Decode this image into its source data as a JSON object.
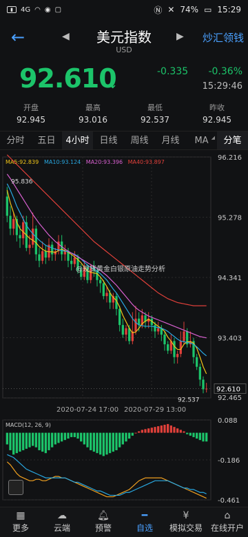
{
  "status_bar": {
    "carrier_left": "4G",
    "battery": "74%",
    "time": "15:29"
  },
  "header": {
    "title": "美元指数",
    "subtitle": "USD",
    "right_link": "炒汇领钱"
  },
  "quote": {
    "price": "92.610",
    "change": "-0.335",
    "change_pct": "-0.36%",
    "time": "15:29:46"
  },
  "stats": [
    {
      "label": "开盘",
      "value": "92.945"
    },
    {
      "label": "最高",
      "value": "93.016"
    },
    {
      "label": "最低",
      "value": "92.537"
    },
    {
      "label": "昨收",
      "value": "92.945"
    }
  ],
  "tabs": [
    "分时",
    "五日",
    "4小时",
    "日线",
    "周线",
    "月线",
    "MA",
    "分笔"
  ],
  "chart_data": {
    "type": "candlestick",
    "ma_legend": [
      {
        "label": "MA5:92.839",
        "color": "#f0c419"
      },
      {
        "label": "MA10:93.124",
        "color": "#29a7e0"
      },
      {
        "label": "MA20:93.396",
        "color": "#d860d0"
      },
      {
        "label": "MA40:93.897",
        "color": "#e0403a"
      }
    ],
    "y_ticks": [
      "96.216",
      "95.278",
      "94.341",
      "93.403",
      "92.465"
    ],
    "current_price_label": "92.610",
    "annotations": [
      {
        "label": "95.836"
      },
      {
        "label": "92.537"
      }
    ],
    "x_ticks": [
      "2020-07-24 17:00",
      "2020-07-29 13:00"
    ],
    "ylim": [
      92.465,
      96.216
    ],
    "candles": [
      [
        95.6,
        95.3,
        95.75,
        95.2
      ],
      [
        95.3,
        95.1,
        95.45,
        95.0
      ],
      [
        95.1,
        95.25,
        95.35,
        95.0
      ],
      [
        95.25,
        95.0,
        95.3,
        94.9
      ],
      [
        95.0,
        94.95,
        95.15,
        94.8
      ],
      [
        94.95,
        95.2,
        95.3,
        94.85
      ],
      [
        95.2,
        94.8,
        95.3,
        94.75
      ],
      [
        94.8,
        94.85,
        95.0,
        94.7
      ],
      [
        94.85,
        95.1,
        95.35,
        94.8
      ],
      [
        95.1,
        94.7,
        95.15,
        94.6
      ],
      [
        94.7,
        94.6,
        94.8,
        94.5
      ],
      [
        94.6,
        94.75,
        94.9,
        94.55
      ],
      [
        94.75,
        94.65,
        94.85,
        94.55
      ],
      [
        94.65,
        94.85,
        94.95,
        94.6
      ],
      [
        94.85,
        94.7,
        94.9,
        94.6
      ],
      [
        94.7,
        94.75,
        94.8,
        94.6
      ],
      [
        94.75,
        94.9,
        95.0,
        94.7
      ],
      [
        94.9,
        94.7,
        95.0,
        94.6
      ],
      [
        94.7,
        94.75,
        94.85,
        94.6
      ],
      [
        94.75,
        94.6,
        94.8,
        94.5
      ],
      [
        94.6,
        94.55,
        94.7,
        94.45
      ],
      [
        94.55,
        94.65,
        94.75,
        94.5
      ],
      [
        94.65,
        94.45,
        94.7,
        94.4
      ],
      [
        94.45,
        94.35,
        94.55,
        94.3
      ],
      [
        94.35,
        94.5,
        94.6,
        94.3
      ],
      [
        94.5,
        94.3,
        94.55,
        94.25
      ],
      [
        94.3,
        94.5,
        94.55,
        94.25
      ],
      [
        94.5,
        94.45,
        94.6,
        94.35
      ],
      [
        94.45,
        94.3,
        94.5,
        94.2
      ],
      [
        94.3,
        94.25,
        94.35,
        94.1
      ],
      [
        94.25,
        94.05,
        94.3,
        94.0
      ],
      [
        94.05,
        94.1,
        94.2,
        93.95
      ],
      [
        94.1,
        93.95,
        94.15,
        93.85
      ],
      [
        93.95,
        94.05,
        94.1,
        93.85
      ],
      [
        94.05,
        93.85,
        94.1,
        93.75
      ],
      [
        93.85,
        93.6,
        93.9,
        93.5
      ],
      [
        93.6,
        93.45,
        93.7,
        93.4
      ],
      [
        93.45,
        93.55,
        93.6,
        93.35
      ],
      [
        93.55,
        93.35,
        93.6,
        93.3
      ],
      [
        93.35,
        93.5,
        93.8,
        93.3
      ],
      [
        93.5,
        93.7,
        93.9,
        93.45
      ],
      [
        93.7,
        93.6,
        93.8,
        93.5
      ],
      [
        93.6,
        93.75,
        93.85,
        93.55
      ],
      [
        93.75,
        93.65,
        93.8,
        93.55
      ],
      [
        93.65,
        93.7,
        93.8,
        93.55
      ],
      [
        93.7,
        93.6,
        93.75,
        93.5
      ],
      [
        93.6,
        93.5,
        93.65,
        93.4
      ],
      [
        93.5,
        93.55,
        93.65,
        93.45
      ],
      [
        93.55,
        93.45,
        93.6,
        93.35
      ],
      [
        93.45,
        93.3,
        93.5,
        93.2
      ],
      [
        93.3,
        93.2,
        93.35,
        93.15
      ],
      [
        93.2,
        93.35,
        93.45,
        93.15
      ],
      [
        93.35,
        93.1,
        93.4,
        93.0
      ],
      [
        93.1,
        93.15,
        93.2,
        93.0
      ],
      [
        93.15,
        93.35,
        93.5,
        93.1
      ],
      [
        93.35,
        93.5,
        93.65,
        93.3
      ],
      [
        93.5,
        93.3,
        93.55,
        93.25
      ],
      [
        93.3,
        93.35,
        93.5,
        93.25
      ],
      [
        93.35,
        93.1,
        93.4,
        93.0
      ],
      [
        93.1,
        92.95,
        93.15,
        92.9
      ],
      [
        92.95,
        92.75,
        93.0,
        92.65
      ],
      [
        92.75,
        92.6,
        92.8,
        92.537
      ],
      [
        92.6,
        92.61,
        92.7,
        92.55
      ]
    ],
    "ma_lines": {
      "ma5": [
        95.7,
        95.5,
        95.35,
        95.2,
        95.1,
        95.05,
        95.0,
        94.95,
        94.92,
        94.88,
        94.82,
        94.78,
        94.75,
        94.74,
        94.74,
        94.73,
        94.76,
        94.78,
        94.76,
        94.73,
        94.7,
        94.66,
        94.62,
        94.57,
        94.5,
        94.44,
        94.42,
        94.41,
        94.4,
        94.35,
        94.28,
        94.2,
        94.1,
        94.03,
        93.98,
        93.88,
        93.75,
        93.65,
        93.55,
        93.48,
        93.49,
        93.55,
        93.62,
        93.66,
        93.69,
        93.66,
        93.62,
        93.58,
        93.55,
        93.5,
        93.41,
        93.35,
        93.27,
        93.22,
        93.22,
        93.3,
        93.34,
        93.34,
        93.32,
        93.24,
        93.1,
        92.95,
        92.84
      ],
      "ma10": [
        95.8,
        95.7,
        95.58,
        95.45,
        95.35,
        95.25,
        95.15,
        95.08,
        95.02,
        94.97,
        94.92,
        94.88,
        94.84,
        94.82,
        94.8,
        94.78,
        94.77,
        94.76,
        94.75,
        94.74,
        94.72,
        94.7,
        94.67,
        94.63,
        94.58,
        94.53,
        94.5,
        94.47,
        94.44,
        94.4,
        94.35,
        94.3,
        94.23,
        94.16,
        94.1,
        94.02,
        93.94,
        93.86,
        93.78,
        93.7,
        93.64,
        93.6,
        93.59,
        93.58,
        93.58,
        93.58,
        93.57,
        93.56,
        93.55,
        93.53,
        93.5,
        93.46,
        93.42,
        93.38,
        93.35,
        93.34,
        93.33,
        93.32,
        93.3,
        93.26,
        93.21,
        93.16,
        93.12
      ],
      "ma20": [
        95.95,
        95.88,
        95.8,
        95.72,
        95.64,
        95.56,
        95.48,
        95.4,
        95.32,
        95.25,
        95.18,
        95.12,
        95.06,
        95.0,
        94.95,
        94.9,
        94.86,
        94.82,
        94.78,
        94.75,
        94.72,
        94.69,
        94.66,
        94.63,
        94.6,
        94.57,
        94.54,
        94.51,
        94.48,
        94.45,
        94.41,
        94.37,
        94.32,
        94.27,
        94.22,
        94.16,
        94.1,
        94.04,
        93.98,
        93.92,
        93.87,
        93.83,
        93.8,
        93.77,
        93.74,
        93.72,
        93.7,
        93.68,
        93.66,
        93.64,
        93.62,
        93.6,
        93.58,
        93.56,
        93.54,
        93.52,
        93.5,
        93.48,
        93.46,
        93.44,
        93.42,
        93.41,
        93.4
      ],
      "ma40": [
        96.25,
        96.2,
        96.15,
        96.1,
        96.05,
        96.0,
        95.95,
        95.9,
        95.85,
        95.8,
        95.75,
        95.7,
        95.65,
        95.6,
        95.55,
        95.5,
        95.45,
        95.4,
        95.35,
        95.3,
        95.25,
        95.2,
        95.15,
        95.1,
        95.05,
        95.0,
        94.95,
        94.9,
        94.86,
        94.82,
        94.78,
        94.74,
        94.7,
        94.66,
        94.62,
        94.58,
        94.54,
        94.5,
        94.46,
        94.42,
        94.38,
        94.34,
        94.3,
        94.26,
        94.22,
        94.18,
        94.14,
        94.1,
        94.07,
        94.04,
        94.01,
        93.99,
        93.97,
        93.95,
        93.94,
        93.93,
        93.92,
        93.91,
        93.9,
        93.9,
        93.9,
        93.9,
        93.9
      ]
    }
  },
  "macd_data": {
    "label": "MACD(12, 26, 9)",
    "y_ticks": [
      "0.088",
      "-0.186",
      "-0.461"
    ],
    "ylim": [
      -0.461,
      0.088
    ],
    "hist": [
      -0.08,
      -0.12,
      -0.15,
      -0.14,
      -0.13,
      -0.12,
      -0.11,
      -0.1,
      -0.09,
      -0.1,
      -0.12,
      -0.13,
      -0.14,
      -0.12,
      -0.1,
      -0.08,
      -0.07,
      -0.06,
      -0.05,
      -0.04,
      -0.03,
      -0.03,
      -0.04,
      -0.06,
      -0.08,
      -0.1,
      -0.12,
      -0.13,
      -0.14,
      -0.15,
      -0.16,
      -0.15,
      -0.14,
      -0.13,
      -0.12,
      -0.1,
      -0.08,
      -0.06,
      -0.04,
      -0.02,
      0.0,
      0.01,
      0.02,
      0.025,
      0.03,
      0.035,
      0.04,
      0.045,
      0.05,
      0.055,
      0.06,
      0.05,
      0.04,
      0.03,
      0.02,
      0.01,
      -0.01,
      -0.02,
      -0.03,
      -0.04,
      -0.05,
      -0.06,
      -0.06
    ],
    "dif": [
      -0.2,
      -0.22,
      -0.25,
      -0.28,
      -0.3,
      -0.31,
      -0.32,
      -0.33,
      -0.33,
      -0.32,
      -0.32,
      -0.33,
      -0.33,
      -0.32,
      -0.31,
      -0.3,
      -0.3,
      -0.31,
      -0.31,
      -0.32,
      -0.33,
      -0.34,
      -0.35,
      -0.36,
      -0.37,
      -0.38,
      -0.39,
      -0.4,
      -0.41,
      -0.42,
      -0.43,
      -0.44,
      -0.44,
      -0.44,
      -0.43,
      -0.42,
      -0.41,
      -0.4,
      -0.39,
      -0.37,
      -0.35,
      -0.33,
      -0.32,
      -0.31,
      -0.31,
      -0.31,
      -0.31,
      -0.31,
      -0.31,
      -0.32,
      -0.33,
      -0.34,
      -0.35,
      -0.36,
      -0.37,
      -0.38,
      -0.39,
      -0.4,
      -0.41,
      -0.42,
      -0.43,
      -0.44,
      -0.45
    ],
    "dea": [
      -0.15,
      -0.16,
      -0.17,
      -0.19,
      -0.21,
      -0.23,
      -0.25,
      -0.26,
      -0.27,
      -0.28,
      -0.29,
      -0.3,
      -0.31,
      -0.31,
      -0.31,
      -0.31,
      -0.31,
      -0.31,
      -0.31,
      -0.32,
      -0.33,
      -0.34,
      -0.34,
      -0.35,
      -0.36,
      -0.37,
      -0.38,
      -0.39,
      -0.4,
      -0.4,
      -0.41,
      -0.42,
      -0.43,
      -0.43,
      -0.43,
      -0.43,
      -0.42,
      -0.41,
      -0.41,
      -0.4,
      -0.39,
      -0.38,
      -0.37,
      -0.36,
      -0.35,
      -0.34,
      -0.33,
      -0.33,
      -0.33,
      -0.33,
      -0.33,
      -0.34,
      -0.35,
      -0.36,
      -0.37,
      -0.38,
      -0.38,
      -0.39,
      -0.39,
      -0.4,
      -0.41,
      -0.41,
      -0.42
    ]
  },
  "watermark": "@现货黄金白银原油走势分析",
  "bottom_nav": [
    {
      "label": "更多",
      "icon": "grid-icon"
    },
    {
      "label": "云端",
      "icon": "cloud-icon"
    },
    {
      "label": "预警",
      "icon": "bell-icon"
    },
    {
      "label": "自选",
      "icon": "minus-icon"
    },
    {
      "label": "模拟交易",
      "icon": "yen-icon"
    },
    {
      "label": "在线开户",
      "icon": "bank-icon"
    }
  ],
  "colors": {
    "up": "#e0403a",
    "down": "#1cc46a",
    "accent": "#4aa0ff"
  }
}
